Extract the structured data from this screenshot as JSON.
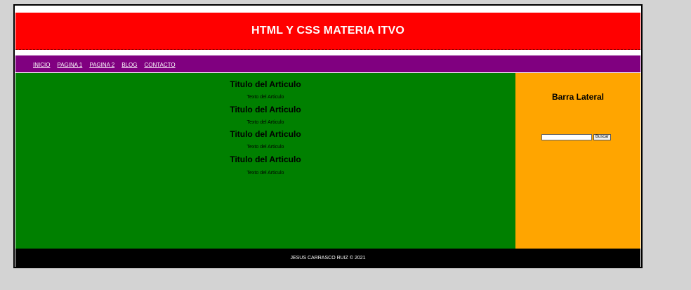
{
  "header": {
    "title": "HTML Y CSS MATERIA ITVO"
  },
  "nav": {
    "items": [
      {
        "label": "INICIO"
      },
      {
        "label": "PAGINA 1"
      },
      {
        "label": "PAGINA 2"
      },
      {
        "label": "BLOG"
      },
      {
        "label": "CONTACTO"
      }
    ]
  },
  "articles": [
    {
      "title": "Titulo del Articulo",
      "text": "Texto del Articulo"
    },
    {
      "title": "Titulo del Articulo",
      "text": "Texto del Articulo"
    },
    {
      "title": "Titulo del Articulo",
      "text": "Texto del Articulo"
    },
    {
      "title": "Titulo del Articulo",
      "text": "Texto del Articulo"
    }
  ],
  "sidebar": {
    "title": "Barra Lateral",
    "search_value": "",
    "search_button": "Buscar"
  },
  "footer": {
    "text": "JESUS CARRASCO RUIZ © 2021"
  },
  "colors": {
    "header": "#ff0000",
    "nav": "#800080",
    "content": "#008000",
    "sidebar": "#ffa500",
    "footer": "#000000",
    "page": "#d3d3d3"
  }
}
